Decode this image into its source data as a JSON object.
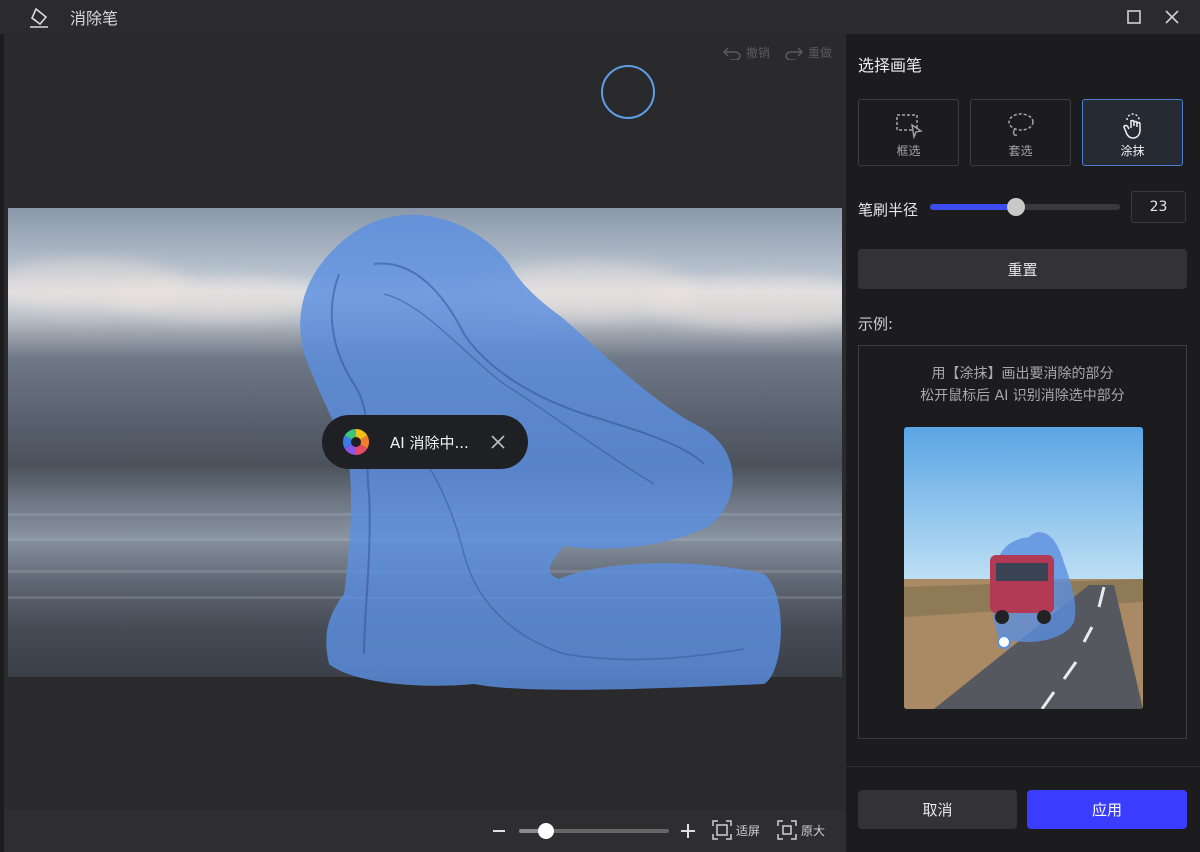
{
  "window": {
    "title": "消除笔",
    "app_icon": "eraser-icon",
    "controls": [
      "maximize-icon",
      "close-icon"
    ]
  },
  "canvas": {
    "undo_label": "撤销",
    "redo_label": "重做",
    "ai_status": "AI 消除中...",
    "mask_color": "#5b8fe0"
  },
  "zoom": {
    "level_fraction": 0.18,
    "fit_label": "适屏",
    "original_label": "原大"
  },
  "panel": {
    "heading": "选择画笔",
    "tools": [
      {
        "label": "框选",
        "icon": "rect-select-icon",
        "active": false
      },
      {
        "label": "套选",
        "icon": "lasso-select-icon",
        "active": false
      },
      {
        "label": "涂抹",
        "icon": "smear-hand-icon",
        "active": true
      }
    ],
    "brush_label": "笔刷半径",
    "brush_value": "23",
    "brush_fraction": 0.45,
    "reset_label": "重置",
    "example_label": "示例:",
    "example_line1": "用【涂抹】画出要消除的部分",
    "example_line2": "松开鼠标后 AI 识别消除选中部分",
    "cancel_label": "取消",
    "apply_label": "应用",
    "accent_color": "#3a3dff"
  }
}
